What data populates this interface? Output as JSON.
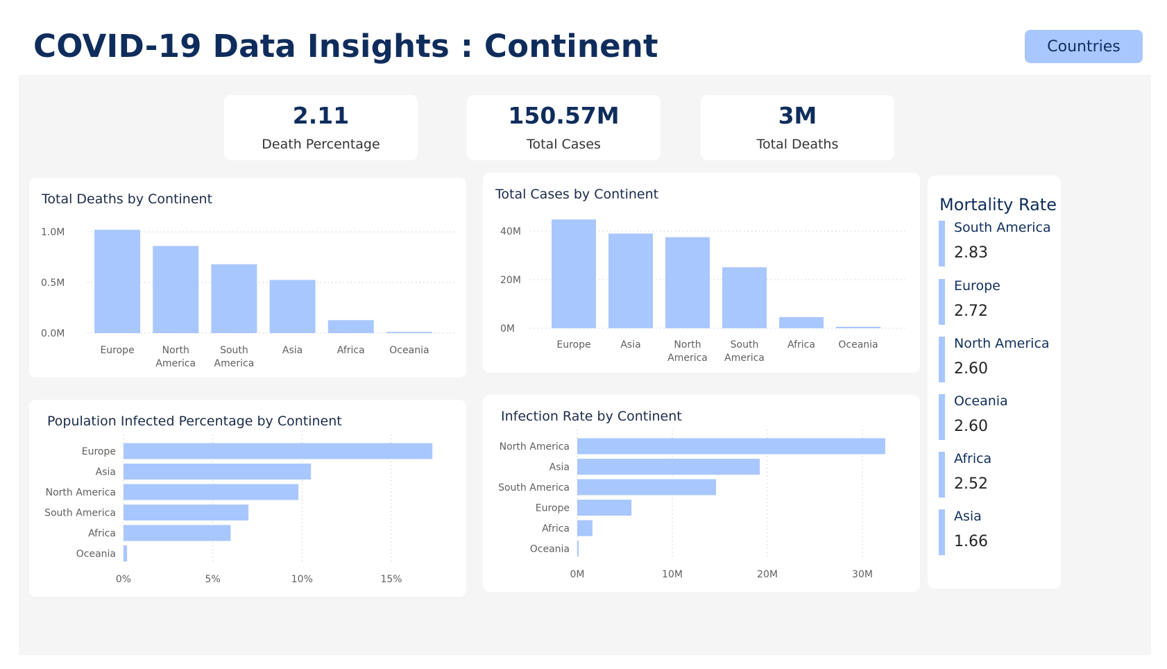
{
  "header": {
    "title": "COVID-19 Data Insights : Continent",
    "nav_button_label": "Countries"
  },
  "kpis": [
    {
      "value": "2.11",
      "label": "Death Percentage"
    },
    {
      "value": "150.57M",
      "label": "Total Cases"
    },
    {
      "value": "3M",
      "label": "Total Deaths"
    }
  ],
  "colors": {
    "bar": "#a9c7ff",
    "title": "#0f2d5c",
    "canvas": "#f5f5f5"
  },
  "chart_data": [
    {
      "id": "total_deaths",
      "type": "bar",
      "title": "Total Deaths by Continent",
      "categories": [
        [
          "Europe"
        ],
        [
          "North",
          "America"
        ],
        [
          "South",
          "America"
        ],
        [
          "Asia"
        ],
        [
          "Africa"
        ],
        [
          "Oceania"
        ]
      ],
      "values": [
        1020000,
        860000,
        680000,
        525000,
        128000,
        12000
      ],
      "yticks": [
        "0.0M",
        "0.5M",
        "1.0M"
      ],
      "ytick_values": [
        0,
        500000,
        1000000
      ],
      "ylim": [
        0,
        1000000
      ],
      "grid": true
    },
    {
      "id": "total_cases",
      "type": "bar",
      "title": "Total Cases by Continent",
      "categories": [
        [
          "Europe"
        ],
        [
          "Asia"
        ],
        [
          "North",
          "America"
        ],
        [
          "South",
          "America"
        ],
        [
          "Africa"
        ],
        [
          "Oceania"
        ]
      ],
      "values": [
        44800000,
        39000000,
        37500000,
        25100000,
        4600000,
        600000
      ],
      "yticks": [
        "0M",
        "20M",
        "40M"
      ],
      "ytick_values": [
        0,
        20000000,
        40000000
      ],
      "ylim": [
        0,
        40000000
      ],
      "grid": true
    },
    {
      "id": "pop_infected",
      "type": "bar",
      "orientation": "horizontal",
      "title": "Population Infected Percentage by Continent",
      "categories": [
        "Europe",
        "Asia",
        "North America",
        "South America",
        "Africa",
        "Oceania"
      ],
      "values": [
        17.3,
        10.5,
        9.8,
        7.0,
        6.0,
        0.2
      ],
      "xticks": [
        "0%",
        "5%",
        "10%",
        "15%"
      ],
      "xtick_values": [
        0,
        5,
        10,
        15
      ],
      "xlim": [
        0,
        15
      ],
      "grid": true
    },
    {
      "id": "infection_rate",
      "type": "bar",
      "orientation": "horizontal",
      "title": "Infection Rate by Continent",
      "categories": [
        "North America",
        "Asia",
        "South America",
        "Europe",
        "Africa",
        "Oceania"
      ],
      "values": [
        32400000,
        19200000,
        14600000,
        5700000,
        1600000,
        150000
      ],
      "xticks": [
        "0M",
        "10M",
        "20M",
        "30M"
      ],
      "xtick_values": [
        0,
        10000000,
        20000000,
        30000000
      ],
      "xlim": [
        0,
        30000000
      ],
      "grid": true
    }
  ],
  "mortality": {
    "title": "Mortality Rate",
    "items": [
      {
        "name": "South America",
        "value": "2.83"
      },
      {
        "name": "Europe",
        "value": "2.72"
      },
      {
        "name": "North America",
        "value": "2.60"
      },
      {
        "name": "Oceania",
        "value": "2.60"
      },
      {
        "name": "Africa",
        "value": "2.52"
      },
      {
        "name": "Asia",
        "value": "1.66"
      }
    ]
  }
}
